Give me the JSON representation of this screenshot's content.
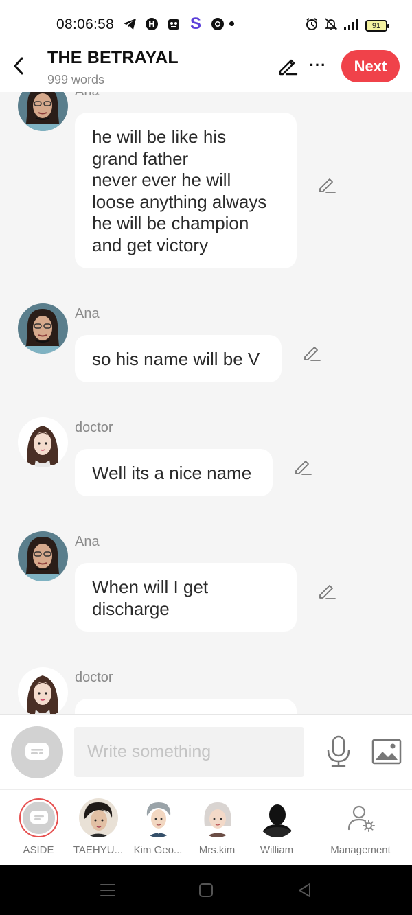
{
  "status_bar": {
    "time": "08:06:58",
    "battery": "91"
  },
  "header": {
    "title": "THE BETRAYAL",
    "word_count": "999 words",
    "next_label": "Next",
    "more_label": "···"
  },
  "messages": [
    {
      "sender": "Ana",
      "text": "he will be like his\ngrand father\nnever ever he will\nloose anything always\nhe will be champion\nand get victory"
    },
    {
      "sender": "Ana",
      "text": "so his name will be V"
    },
    {
      "sender": "doctor",
      "text": "Well its a nice name"
    },
    {
      "sender": "Ana",
      "text": "When will I get\ndischarge"
    },
    {
      "sender": "doctor",
      "text": ""
    }
  ],
  "input": {
    "placeholder": "Write something"
  },
  "characters": [
    {
      "label": "ASIDE"
    },
    {
      "label": "TAEHYU..."
    },
    {
      "label": "Kim Geo..."
    },
    {
      "label": "Mrs.kim"
    },
    {
      "label": "William"
    },
    {
      "label": "Management"
    }
  ],
  "colors": {
    "accent": "#f0424a",
    "background": "#f5f5f5",
    "bubble": "#ffffff",
    "sender_text": "#8a8a8a"
  }
}
